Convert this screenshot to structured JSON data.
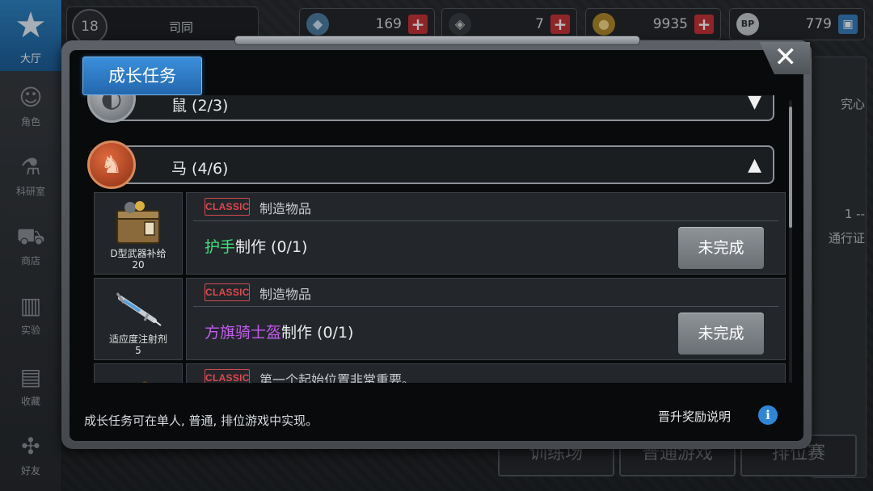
{
  "sidebar": {
    "home_label": "大厅",
    "items": [
      {
        "label": "角色",
        "icon": "character-icon"
      },
      {
        "label": "科研室",
        "icon": "flask-icon"
      },
      {
        "label": "商店",
        "icon": "cart-icon"
      },
      {
        "label": "实验",
        "icon": "books-icon"
      },
      {
        "label": "收藏",
        "icon": "book-icon"
      },
      {
        "label": "好友",
        "icon": "gamepad-icon"
      }
    ]
  },
  "profile": {
    "level": "18",
    "name": "司同"
  },
  "resources": [
    {
      "icon": "crystal-icon",
      "value": "169"
    },
    {
      "icon": "ticket-icon",
      "value": "7"
    },
    {
      "icon": "coin-icon",
      "value": "9935"
    },
    {
      "icon": "bp-icon",
      "value": "779"
    }
  ],
  "background": {
    "right_texts": [
      "究心",
      "1 --",
      "通行证"
    ],
    "bottom_buttons": [
      "训练场",
      "普通游戏",
      "排位赛"
    ]
  },
  "modal": {
    "tab_label": "成长任务",
    "close_label": "✕",
    "groups": [
      {
        "title": "鼠 (2/3)",
        "arrow": "▼",
        "expanded": false
      },
      {
        "title": "马 (4/6)",
        "arrow": "▲",
        "expanded": true
      }
    ],
    "tasks": [
      {
        "badge": "CLASSIC",
        "type": "制造物品",
        "name_highlight": "护手",
        "name_rest": "制作 (0/1)",
        "highlight_color": "#3ee07a",
        "status": "未完成",
        "reward_name": "D型武器补给",
        "reward_qty": "20",
        "reward_icon": "crate-icon"
      },
      {
        "badge": "CLASSIC",
        "type": "制造物品",
        "name_highlight": "方旗骑士盔",
        "name_rest": "制作 (0/1)",
        "highlight_color": "#c45bf0",
        "status": "未完成",
        "reward_name": "适应度注射剂",
        "reward_qty": "5",
        "reward_icon": "syringe-icon"
      },
      {
        "badge": "CLASSIC",
        "type": "第一个起始位置非常重要。",
        "name_highlight": "",
        "name_rest": "",
        "highlight_color": "#eaeaea",
        "status": "",
        "reward_name": "",
        "reward_qty": "",
        "reward_icon": "box-icon"
      }
    ],
    "footer_note": "成长任务可在单人, 普通, 排位游戏中实现。",
    "footer_link": "晋升奖励说明",
    "info_label": "i"
  },
  "colors": {
    "accent": "#2f86d6",
    "danger": "#c8343a",
    "classic": "#e0474d"
  }
}
